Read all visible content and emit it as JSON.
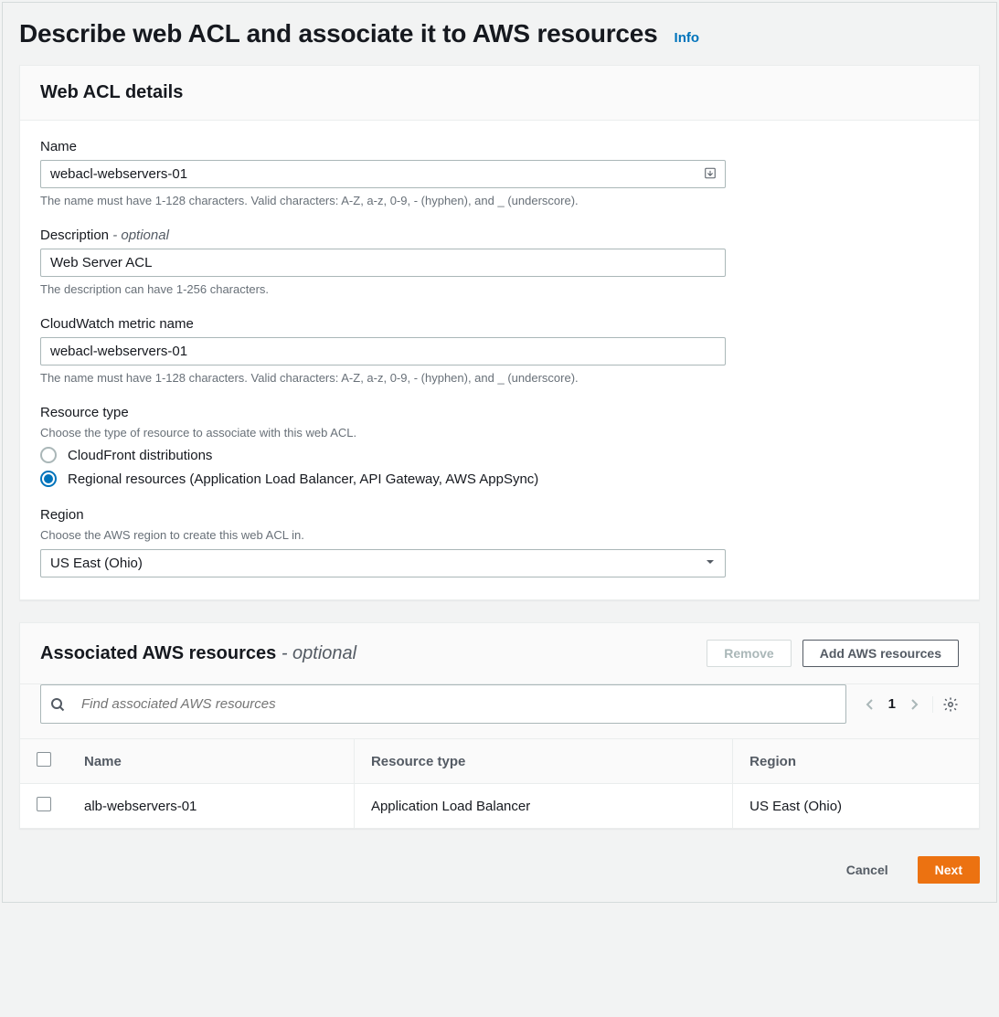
{
  "header": {
    "title": "Describe web ACL and associate it to AWS resources",
    "info_label": "Info"
  },
  "details_panel": {
    "title": "Web ACL details",
    "name": {
      "label": "Name",
      "value": "webacl-webservers-01",
      "help": "The name must have 1-128 characters. Valid characters: A-Z, a-z, 0-9, - (hyphen), and _ (underscore)."
    },
    "description": {
      "label": "Description",
      "optional": " - optional",
      "value": "Web Server ACL",
      "help": "The description can have 1-256 characters."
    },
    "metric": {
      "label": "CloudWatch metric name",
      "value": "webacl-webservers-01",
      "help": "The name must have 1-128 characters. Valid characters: A-Z, a-z, 0-9, - (hyphen), and _ (underscore)."
    },
    "resource_type": {
      "label": "Resource type",
      "desc": "Choose the type of resource to associate with this web ACL.",
      "options": [
        {
          "label": "CloudFront distributions",
          "selected": false
        },
        {
          "label": "Regional resources (Application Load Balancer, API Gateway, AWS AppSync)",
          "selected": true
        }
      ]
    },
    "region": {
      "label": "Region",
      "desc": "Choose the AWS region to create this web ACL in.",
      "value": "US East (Ohio)"
    }
  },
  "resources_panel": {
    "title": "Associated AWS resources",
    "optional": " - optional",
    "actions": {
      "remove": "Remove",
      "add": "Add AWS resources"
    },
    "search_placeholder": "Find associated AWS resources",
    "pagination": {
      "current": "1"
    },
    "columns": [
      "Name",
      "Resource type",
      "Region"
    ],
    "rows": [
      {
        "name": "alb-webservers-01",
        "type": "Application Load Balancer",
        "region": "US East (Ohio)"
      }
    ]
  },
  "footer": {
    "cancel": "Cancel",
    "next": "Next"
  }
}
